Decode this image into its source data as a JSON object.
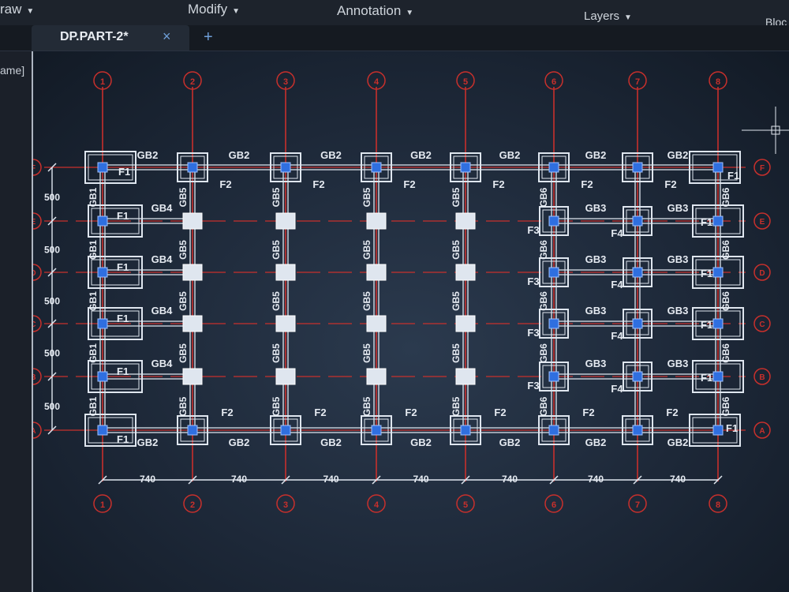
{
  "ribbon": {
    "draw_label": "raw",
    "modify_label": "Modify",
    "annotation_label": "Annotation",
    "layers_label": "Layers",
    "block_label": "Bloc"
  },
  "tab": {
    "label": "DP.PART-2*",
    "add": "+",
    "close": "×"
  },
  "side_panel": {
    "label": "ame]"
  },
  "drawing": {
    "grid_columns": [
      "1",
      "2",
      "3",
      "4",
      "5",
      "6",
      "7",
      "8"
    ],
    "grid_rows": [
      "F",
      "E",
      "D",
      "C",
      "B",
      "A"
    ],
    "column_spacing": [
      "740",
      "740",
      "740",
      "740",
      "740",
      "740",
      "740"
    ],
    "row_spacing": [
      "500",
      "500",
      "500",
      "500",
      "500"
    ],
    "beam_top": [
      "GB2",
      "GB2",
      "GB2",
      "GB2",
      "GB2",
      "GB2",
      "GB2"
    ],
    "beam_bottom": [
      "GB2",
      "GB2",
      "GB2",
      "GB2",
      "GB2",
      "GB2",
      "GB2"
    ],
    "beam_left_bays": [
      "GB4",
      "GB4",
      "GB4",
      "GB4"
    ],
    "beam_right_bay1": [
      "GB3",
      "GB3",
      "GB3",
      "GB3"
    ],
    "beam_right_bay2": [
      "GB3",
      "GB3",
      "GB3",
      "GB3"
    ],
    "col_beam_left": "GB1",
    "col_beam_mid": "GB5",
    "col_beam_right": "GB6",
    "footing_top": [
      "F1",
      "F2",
      "F2",
      "F2",
      "F2",
      "F2",
      "F2",
      "F1"
    ],
    "footing_bottom": [
      "F1",
      "F2",
      "F2",
      "F2",
      "F2",
      "F2",
      "F2",
      "F1"
    ],
    "footing_left": [
      "F1",
      "F1",
      "F1",
      "F1"
    ],
    "footing_col6": [
      "F3",
      "F3",
      "F3",
      "F3"
    ],
    "footing_col7": [
      "F4",
      "F4",
      "F4",
      "F4"
    ],
    "footing_right": [
      "F1",
      "F1",
      "F1",
      "F1"
    ]
  },
  "colors": {
    "grid_line": "#c8302c",
    "footing": "#dfe6ef",
    "column": "#2f6fe0",
    "text": "#e6ebf2"
  }
}
